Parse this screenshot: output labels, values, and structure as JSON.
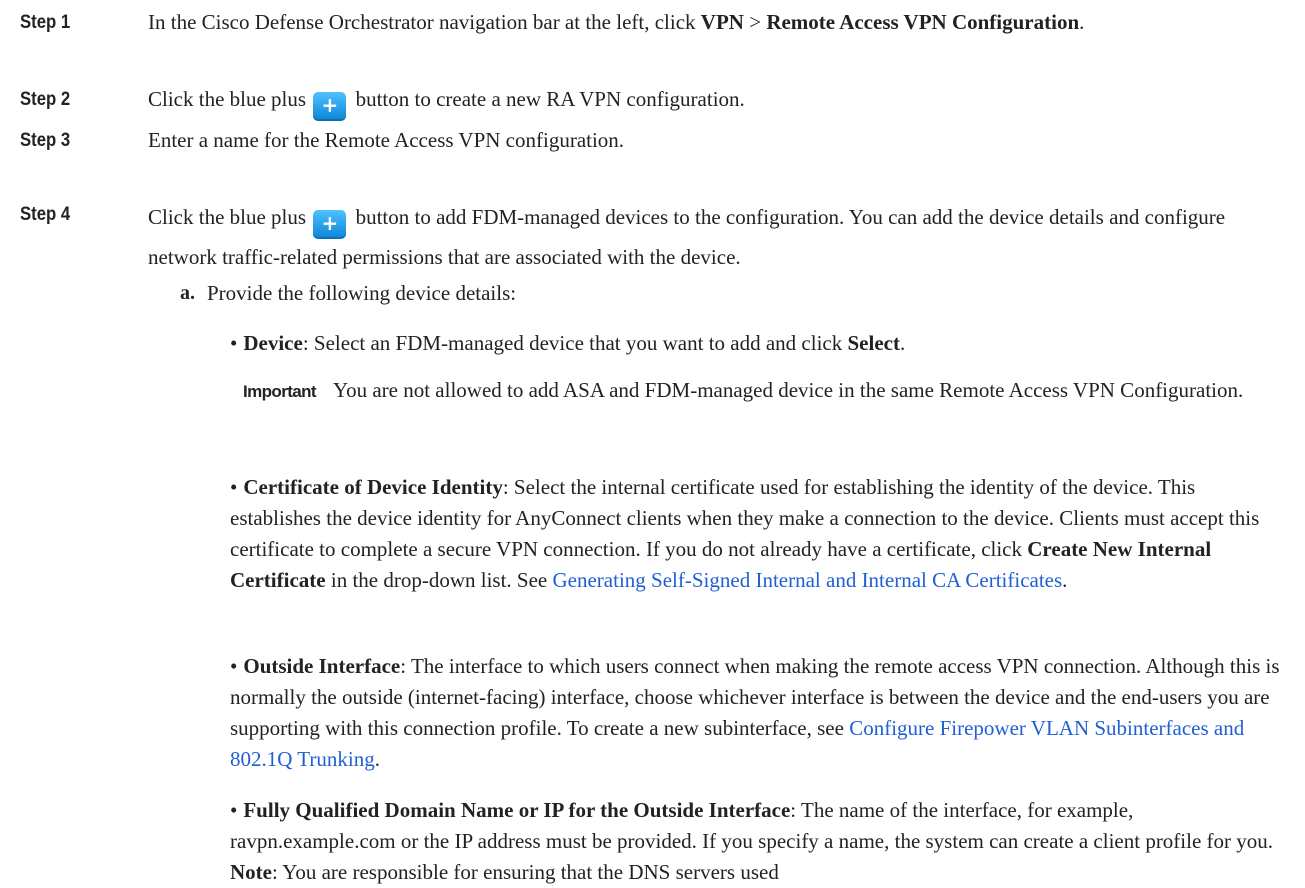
{
  "steps": [
    {
      "label": "Step 1",
      "text_pre": "In the Cisco Defense Orchestrator navigation bar at the left, click ",
      "bold1": "VPN",
      "sep": " > ",
      "bold2": "Remote Access VPN Configuration",
      "text_post": "."
    },
    {
      "label": "Step 2",
      "text_pre": "Click the blue plus ",
      "text_post": " button to create a new RA VPN configuration."
    },
    {
      "label": "Step 3",
      "text": "Enter a name for the Remote Access VPN configuration."
    },
    {
      "label": "Step 4",
      "text_pre": "Click the blue plus ",
      "text_post": " button to add FDM-managed devices to the configuration. You can add the device details and configure network traffic-related permissions that are associated with the device."
    }
  ],
  "substep": {
    "label": "a.",
    "text": "Provide the following device details:"
  },
  "bullets": {
    "device": {
      "term": "Device",
      "text_pre": ": Select an FDM-managed device that you want to add and click ",
      "bold": "Select",
      "text_post": "."
    },
    "important": {
      "label": "Important",
      "text": "You are not allowed to add ASA and FDM-managed device in the same Remote Access VPN Configuration."
    },
    "certificate": {
      "term": "Certificate of Device Identity",
      "text_pre": ": Select the internal certificate used for establishing the identity of the device. This establishes the device identity for AnyConnect clients when they make a connection to the device. Clients must accept this certificate to complete a secure VPN connection. If you do not already have a certificate, click ",
      "bold": "Create New Internal Certificate",
      "text_mid": " in the drop-down list. See ",
      "link": "Generating Self-Signed Internal and Internal CA Certificates",
      "text_post": "."
    },
    "outside": {
      "term": "Outside Interface",
      "text_pre": ": The interface to which users connect when making the remote access VPN connection. Although this is normally the outside (internet-facing) interface, choose whichever interface is between the device and the end-users you are supporting with this connection profile. To create a new subinterface, see ",
      "link": "Configure Firepower VLAN Subinterfaces and 802.1Q Trunking",
      "text_post": "."
    },
    "fqdn": {
      "term": "Fully Qualified Domain Name or IP for the Outside Interface",
      "text_pre": ": The name of the interface, for example, ravpn.example.com or the IP address must be provided. If you specify a name, the system can create a client profile for you. ",
      "bold": "Note",
      "text_post": ": You are responsible for ensuring that the DNS servers used"
    }
  },
  "icons": {
    "plus_button_color": "#1a9cf0",
    "link_color": "#1f5fd6"
  }
}
